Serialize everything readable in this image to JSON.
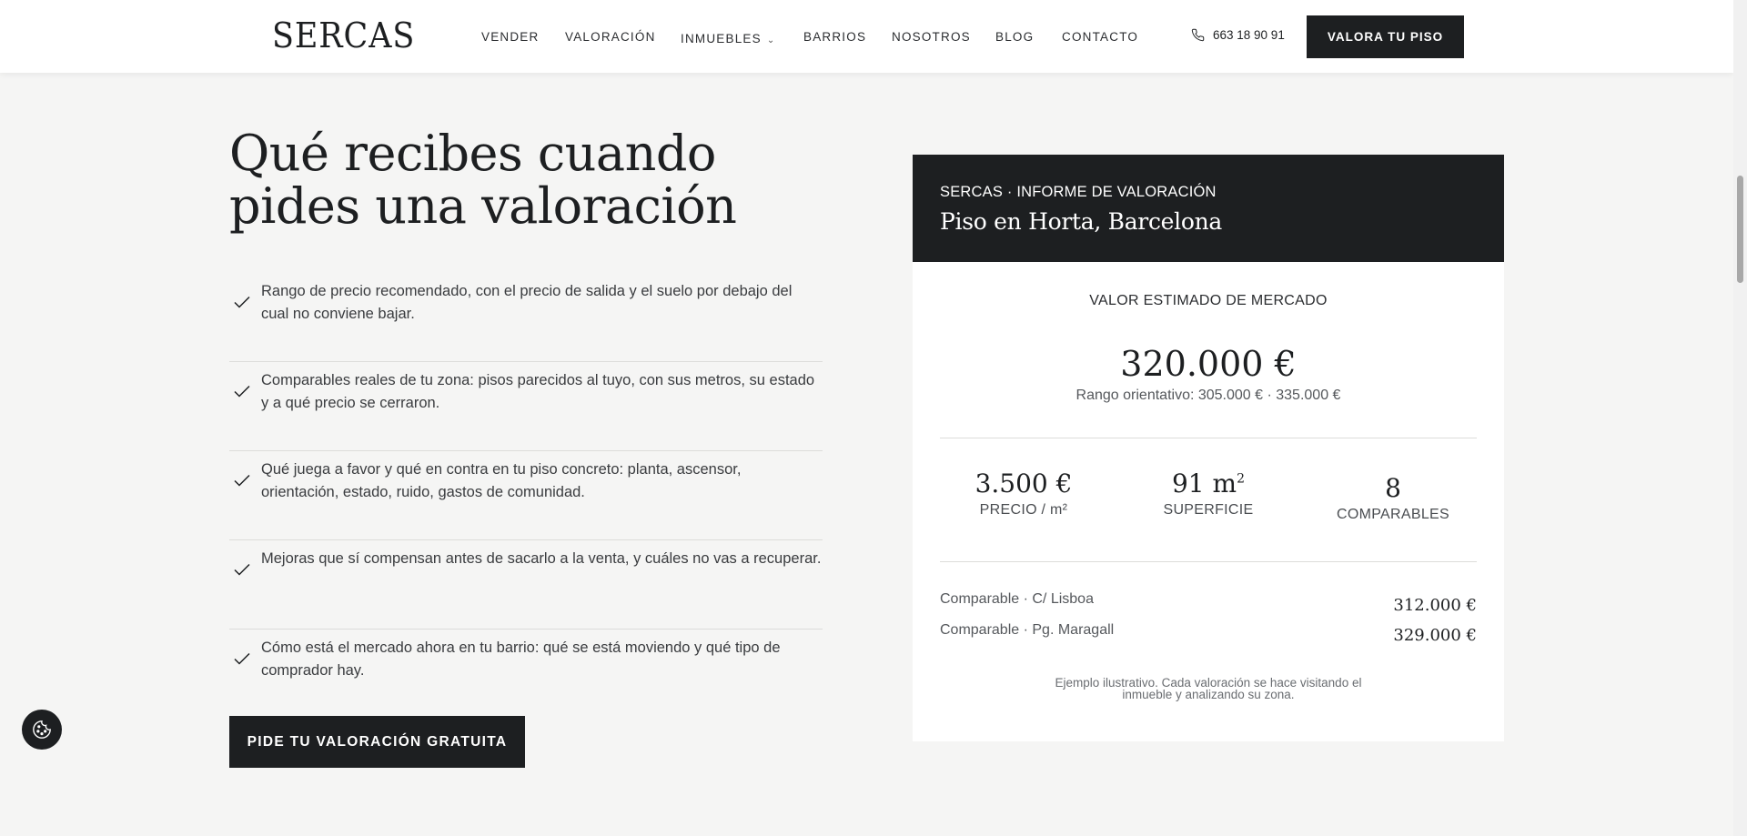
{
  "header": {
    "logo": "SERCAS",
    "nav": [
      {
        "label": "VENDER"
      },
      {
        "label": "VALORACIÓN"
      },
      {
        "label": "INMUEBLES"
      },
      {
        "label": "BARRIOS"
      },
      {
        "label": "NOSOTROS"
      },
      {
        "label": "BLOG"
      },
      {
        "label": "CONTACTO"
      }
    ],
    "phone": "663 18 90 91",
    "cta": "VALORA TU PISO"
  },
  "main": {
    "title": "Qué recibes cuando pides una valoración",
    "bullets": [
      "Rango de precio recomendado, con el precio de salida y el suelo por debajo del cual no conviene bajar.",
      "Comparables reales de tu zona: pisos parecidos al tuyo, con sus metros, su estado y a qué precio se cerraron.",
      "Qué juega a favor y qué en contra en tu piso concreto: planta, ascensor, orientación, estado, ruido, gastos de comunidad.",
      "Mejoras que sí compensan antes de sacarlo a la venta, y cuáles no vas a recuperar.",
      "Cómo está el mercado ahora en tu barrio: qué se está moviendo y qué tipo de comprador hay."
    ],
    "cta": "PIDE TU VALORACIÓN GRATUITA"
  },
  "report": {
    "kicker": "SERCAS · INFORME DE VALORACIÓN",
    "subtitle": "Piso en Horta, Barcelona",
    "market_label": "VALOR ESTIMADO DE MERCADO",
    "market_value": "320.000 €",
    "range": "Rango orientativo: 305.000 € · 335.000 €",
    "stats": [
      {
        "value": "3.500 €",
        "label": "PRECIO / m²"
      },
      {
        "value": "91 m",
        "sup": "2",
        "label": "SUPERFICIE"
      },
      {
        "value": "8",
        "label": "COMPARABLES"
      }
    ],
    "comparables": [
      {
        "name": "Comparable · C/ Lisboa",
        "price": "312.000 €"
      },
      {
        "name": "Comparable · Pg. Maragall",
        "price": "329.000 €"
      }
    ],
    "note": "Ejemplo ilustrativo. Cada valoración se hace visitando el inmueble y analizando su zona."
  },
  "icons": {
    "phone": "phone-icon",
    "check": "check-icon",
    "cookie": "cookie-icon",
    "chevron": "chevron-down-icon"
  },
  "colors": {
    "dark": "#1d1f21",
    "background": "#f5f5f4",
    "card": "#ffffff"
  }
}
